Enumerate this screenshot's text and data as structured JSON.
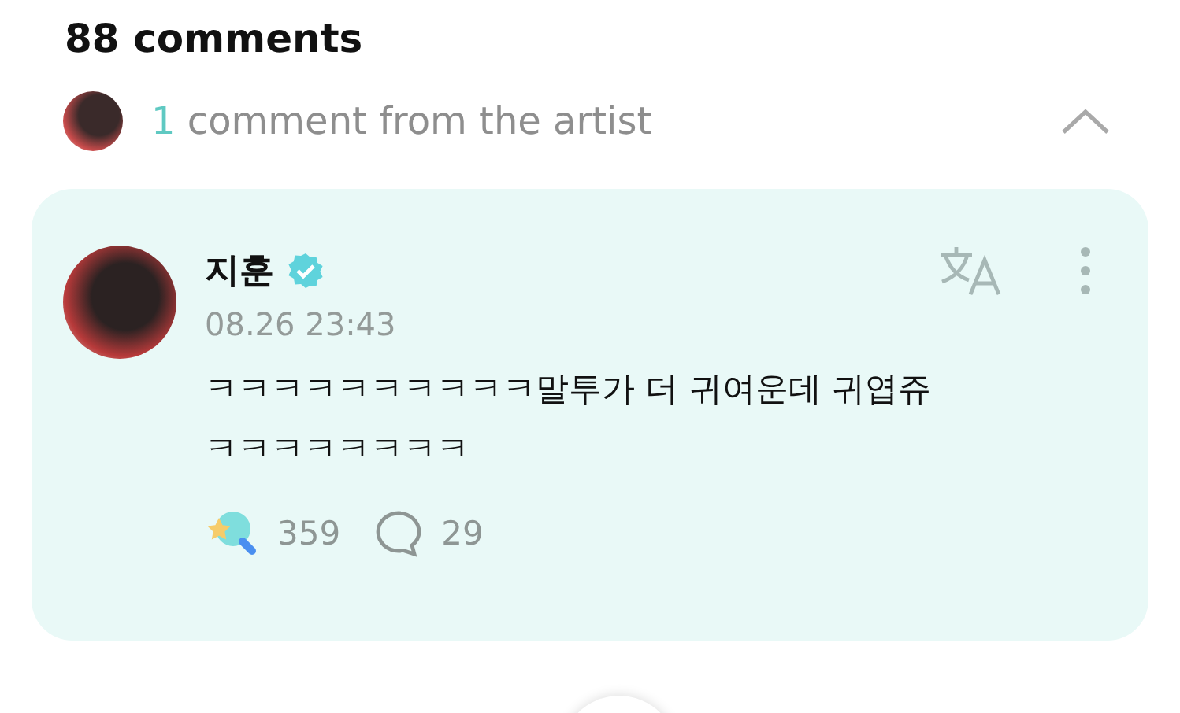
{
  "comments_header": {
    "title": "88 comments"
  },
  "artist_section": {
    "count": "1",
    "label": "comment from the artist",
    "expanded": true
  },
  "comments": [
    {
      "author": "지훈",
      "verified": true,
      "time": "08.26 23:43",
      "text": "ㅋㅋㅋㅋㅋㅋㅋㅋㅋㅋ말투가 더 귀여운데 귀엽쥬 ㅋㅋㅋㅋㅋㅋㅋㅋ",
      "reactions": "359",
      "replies": "29"
    }
  ]
}
